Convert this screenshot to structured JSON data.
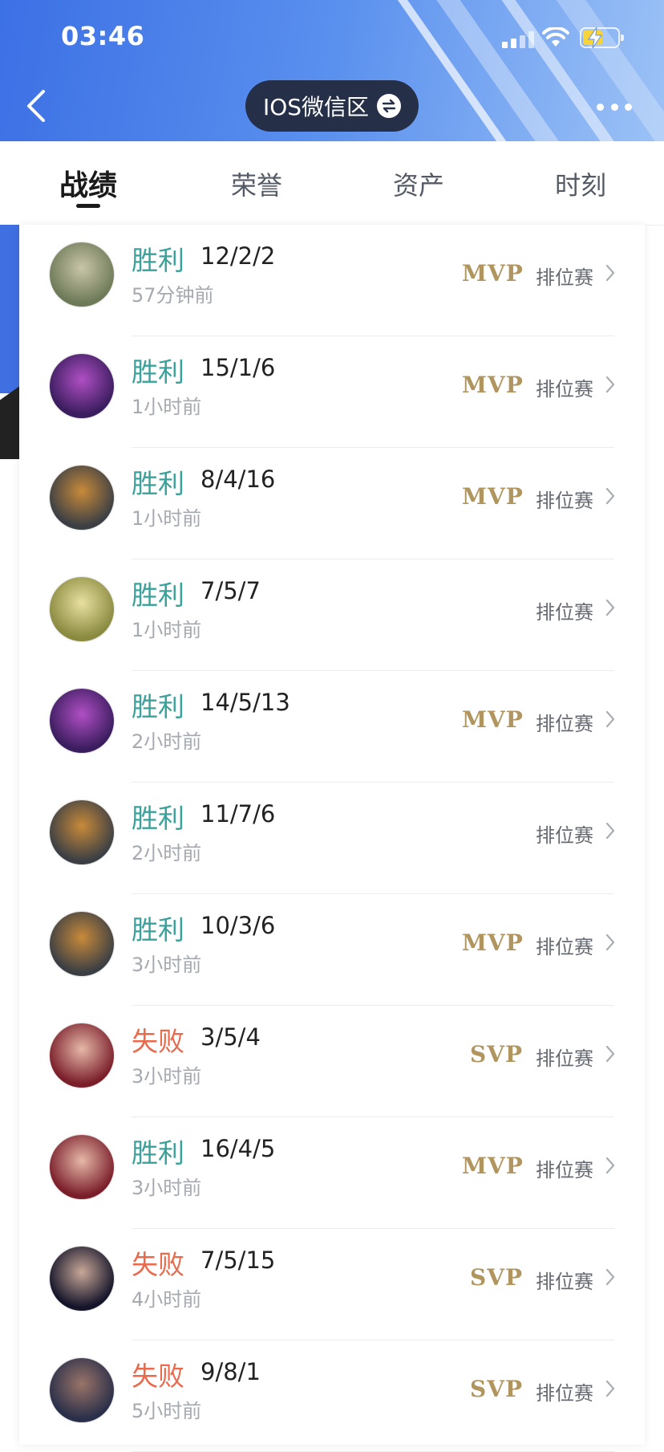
{
  "status_bar": {
    "time": "03:46"
  },
  "nav": {
    "region": "IOS微信区"
  },
  "tabs": [
    {
      "label": "战绩",
      "active": true
    },
    {
      "label": "荣誉",
      "active": false
    },
    {
      "label": "资产",
      "active": false
    },
    {
      "label": "时刻",
      "active": false
    }
  ],
  "matches": [
    {
      "result": "胜利",
      "kda": "12/2/2",
      "time": "57分钟前",
      "badge": "MVP",
      "mode": "排位赛",
      "avatar": "hero-avatar-icon"
    },
    {
      "result": "胜利",
      "kda": "15/1/6",
      "time": "1小时前",
      "badge": "MVP",
      "mode": "排位赛",
      "avatar": "hero-avatar-icon"
    },
    {
      "result": "胜利",
      "kda": "8/4/16",
      "time": "1小时前",
      "badge": "MVP",
      "mode": "排位赛",
      "avatar": "hero-avatar-icon"
    },
    {
      "result": "胜利",
      "kda": "7/5/7",
      "time": "1小时前",
      "badge": "",
      "mode": "排位赛",
      "avatar": "hero-avatar-icon"
    },
    {
      "result": "胜利",
      "kda": "14/5/13",
      "time": "2小时前",
      "badge": "MVP",
      "mode": "排位赛",
      "avatar": "hero-avatar-icon"
    },
    {
      "result": "胜利",
      "kda": "11/7/6",
      "time": "2小时前",
      "badge": "",
      "mode": "排位赛",
      "avatar": "hero-avatar-icon"
    },
    {
      "result": "胜利",
      "kda": "10/3/6",
      "time": "3小时前",
      "badge": "MVP",
      "mode": "排位赛",
      "avatar": "hero-avatar-icon"
    },
    {
      "result": "失败",
      "kda": "3/5/4",
      "time": "3小时前",
      "badge": "SVP",
      "mode": "排位赛",
      "avatar": "hero-avatar-icon"
    },
    {
      "result": "胜利",
      "kda": "16/4/5",
      "time": "3小时前",
      "badge": "MVP",
      "mode": "排位赛",
      "avatar": "hero-avatar-icon"
    },
    {
      "result": "失败",
      "kda": "7/5/15",
      "time": "4小时前",
      "badge": "SVP",
      "mode": "排位赛",
      "avatar": "hero-avatar-icon"
    },
    {
      "result": "失败",
      "kda": "9/8/1",
      "time": "5小时前",
      "badge": "SVP",
      "mode": "排位赛",
      "avatar": "hero-avatar-icon"
    }
  ],
  "colors": {
    "win": "#3aa19b",
    "lose": "#ea6a4e",
    "badge_gold": "#b0955f",
    "header_blue": "#3c70e5"
  }
}
